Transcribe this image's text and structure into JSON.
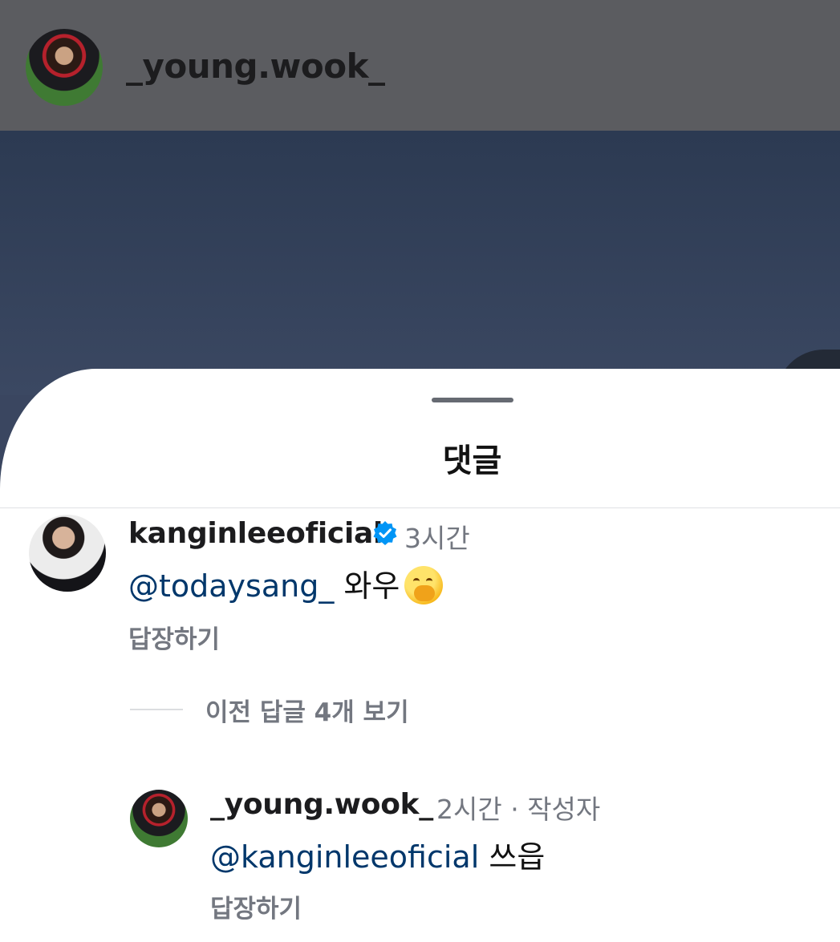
{
  "header": {
    "username": "_young.wook_"
  },
  "sheet": {
    "title": "댓글"
  },
  "comments": [
    {
      "username": "kanginleeoficial",
      "verified": true,
      "time": "3시간",
      "mention": "@todaysang_",
      "text": "와우",
      "emoji": "face-with-hand-over-mouth",
      "reply_label": "답장하기"
    }
  ],
  "view_previous": "이전 답글 4개 보기",
  "replies": [
    {
      "username": "_young.wook_",
      "time": "2시간",
      "author_tag": "· 작성자",
      "mention": "@kanginleeoficial",
      "text": "쓰읍",
      "reply_label": "답장하기"
    }
  ],
  "colors": {
    "mention": "#00376b",
    "verified": "#0095f6",
    "secondary_text": "#737780"
  }
}
